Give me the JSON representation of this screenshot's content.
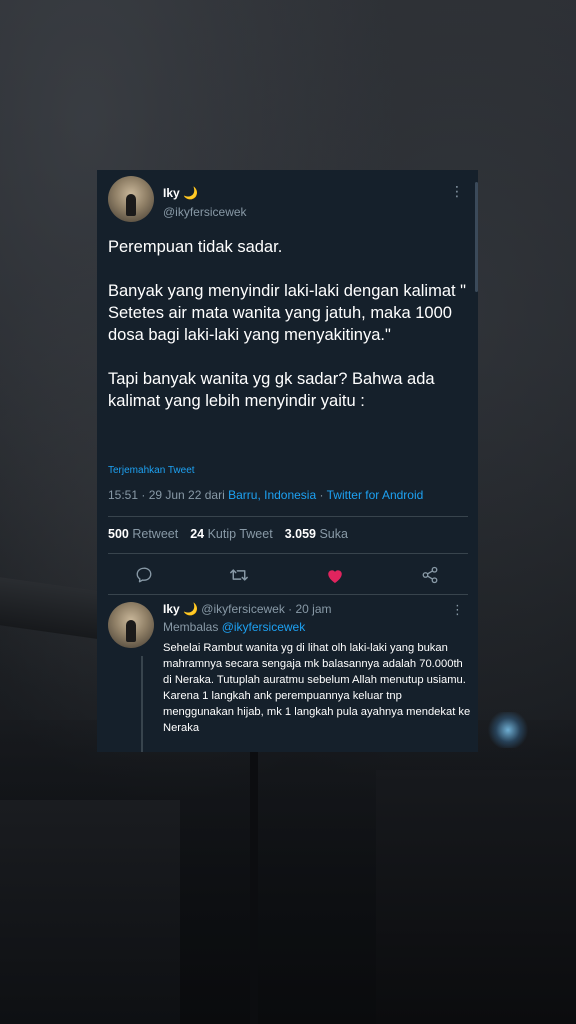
{
  "tweet": {
    "name": "Iky 🌙",
    "handle": "@ikyfersicewek",
    "text": "Perempuan tidak sadar.\n\nBanyak yang menyindir laki-laki dengan kalimat \" Setetes air mata wanita yang jatuh, maka 1000 dosa bagi laki-laki yang menyakitinya.\"\n\nTapi banyak wanita yg gk sadar? Bahwa ada kalimat yang lebih menyindir yaitu :",
    "translate_label": "Terjemahkan Tweet",
    "time": "15:51 · 29 Jun 22 dari ",
    "location": "Barru, Indonesia",
    "sep": " · ",
    "source": "Twitter for Android",
    "stats": {
      "retweets": "500",
      "retweets_label": "Retweet",
      "quotes": "24",
      "quotes_label": "Kutip Tweet",
      "likes": "3.059",
      "likes_label": "Suka"
    }
  },
  "reply": {
    "name": "Iky 🌙",
    "handle_time": " @ikyfersicewek · 20 jam",
    "replying_prefix": "Membalas ",
    "replying_to": "@ikyfersicewek",
    "text": "Sehelai Rambut wanita yg di lihat olh laki-laki yang bukan mahramnya secara sengaja mk balasannya adalah 70.000th di Neraka. Tutuplah auratmu sebelum Allah menutup usiamu. Karena 1 langkah ank perempuannya keluar tnp menggunakan hijab, mk 1 langkah pula ayahnya mendekat ke Neraka"
  },
  "colors": {
    "card_bg": "#15202b",
    "accent": "#1da1f2",
    "muted": "#8899a6",
    "like": "#e0245e"
  },
  "icons": [
    "more-icon",
    "reply-icon",
    "retweet-icon",
    "like-icon",
    "share-icon"
  ]
}
